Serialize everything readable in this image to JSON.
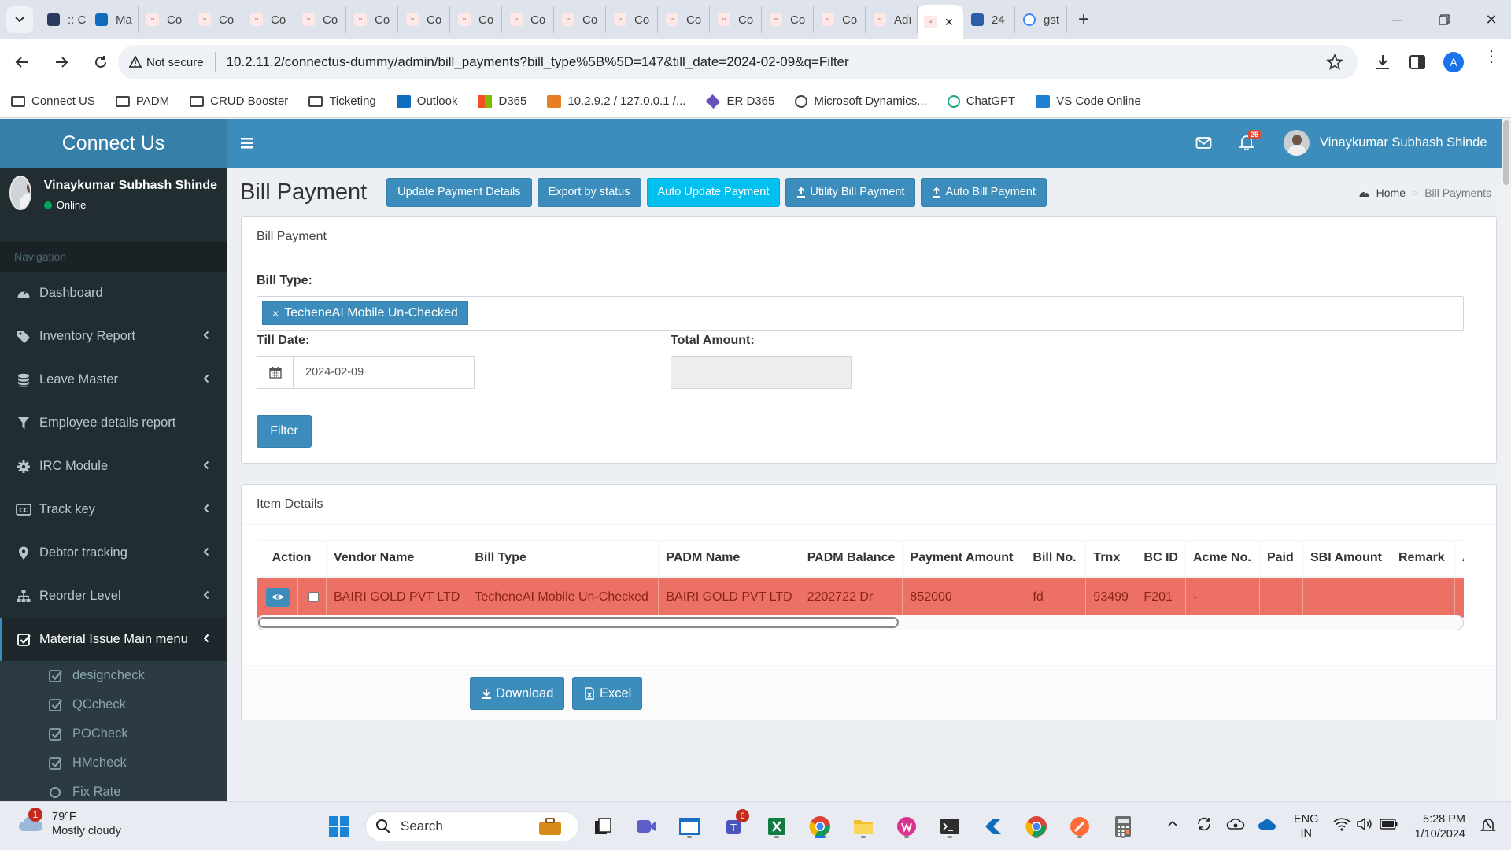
{
  "browser": {
    "tabs": [
      {
        "label": ":: C",
        "icon": "app-icon"
      },
      {
        "label": "Ma",
        "icon": "outlook-icon"
      },
      {
        "label": "Co",
        "icon": "site-icon"
      },
      {
        "label": "Co",
        "icon": "site-icon"
      },
      {
        "label": "Co",
        "icon": "site-icon"
      },
      {
        "label": "Co",
        "icon": "site-icon"
      },
      {
        "label": "Co",
        "icon": "site-icon"
      },
      {
        "label": "Co",
        "icon": "site-icon"
      },
      {
        "label": "Co",
        "icon": "site-icon"
      },
      {
        "label": "Co",
        "icon": "site-icon"
      },
      {
        "label": "Co",
        "icon": "site-icon"
      },
      {
        "label": "Co",
        "icon": "site-icon"
      },
      {
        "label": "Co",
        "icon": "site-icon"
      },
      {
        "label": "Co",
        "icon": "site-icon"
      },
      {
        "label": "Co",
        "icon": "site-icon"
      },
      {
        "label": "Co",
        "icon": "site-icon"
      },
      {
        "label": "Adı",
        "icon": "site-icon"
      }
    ],
    "active_tab_close": "✕",
    "extra_tabs": [
      {
        "label": "24",
        "icon": "app-icon"
      },
      {
        "label": "gst",
        "icon": "google-icon"
      }
    ],
    "new_tab": "+",
    "security_label": "Not secure",
    "url": "10.2.11.2/connectus-dummy/admin/bill_payments?bill_type%5B%5D=147&till_date=2024-02-09&q=Filter",
    "profile_initial": "A",
    "bookmarks": [
      {
        "label": "Connect US",
        "icon": "folder-icon"
      },
      {
        "label": "PADM",
        "icon": "folder-icon"
      },
      {
        "label": "CRUD Booster",
        "icon": "folder-icon"
      },
      {
        "label": "Ticketing",
        "icon": "folder-icon"
      },
      {
        "label": "Outlook",
        "icon": "outlook-icon"
      },
      {
        "label": "D365",
        "icon": "microsoft-icon"
      },
      {
        "label": "10.2.9.2 / 127.0.0.1 /...",
        "icon": "phpmyadmin-icon"
      },
      {
        "label": "ER D365",
        "icon": "diamond-icon"
      },
      {
        "label": "Microsoft Dynamics...",
        "icon": "globe-icon"
      },
      {
        "label": "ChatGPT",
        "icon": "chatgpt-icon"
      },
      {
        "label": "VS Code Online",
        "icon": "vscode-icon"
      }
    ]
  },
  "app": {
    "brand": "Connect Us",
    "header_user": "Vinaykumar Subhash Shinde",
    "notification_count": "25",
    "sidebar": {
      "user_name": "Vinaykumar Subhash Shinde",
      "status": "Online",
      "nav_header": "Navigation",
      "items": [
        {
          "label": "Dashboard",
          "icon": "dashboard-icon",
          "has_children": false
        },
        {
          "label": "Inventory Report",
          "icon": "tag-icon",
          "has_children": true
        },
        {
          "label": "Leave Master",
          "icon": "database-icon",
          "has_children": true
        },
        {
          "label": "Employee details report",
          "icon": "filter-icon",
          "has_children": false
        },
        {
          "label": "IRC Module",
          "icon": "gear-icon",
          "has_children": true
        },
        {
          "label": "Track key",
          "icon": "cc-icon",
          "has_children": true
        },
        {
          "label": "Debtor tracking",
          "icon": "map-marker-icon",
          "has_children": true
        },
        {
          "label": "Reorder Level",
          "icon": "sitemap-icon",
          "has_children": true
        },
        {
          "label": "Material Issue Main menu",
          "icon": "check-square-icon",
          "has_children": true,
          "active": true
        }
      ],
      "sub_items": [
        {
          "label": "designcheck",
          "icon": "check-square-icon"
        },
        {
          "label": "QCcheck",
          "icon": "check-square-icon"
        },
        {
          "label": "POCheck",
          "icon": "check-square-icon"
        },
        {
          "label": "HMcheck",
          "icon": "check-square-icon"
        },
        {
          "label": "Fix Rate",
          "icon": "circle-icon"
        }
      ]
    },
    "page_title": "Bill Payment",
    "actions": [
      "Update Payment Details",
      "Export by status",
      "Auto Update Payment",
      "Utility Bill Payment",
      "Auto Bill Payment"
    ],
    "breadcrumb": {
      "home": "Home",
      "current": "Bill Payments"
    },
    "filter_box": {
      "title": "Bill Payment",
      "bill_type_label": "Bill Type:",
      "bill_type_value": "TecheneAI Mobile Un-Checked",
      "chip_remove": "×",
      "till_date_label": "Till Date:",
      "till_date_value": "2024-02-09",
      "total_amount_label": "Total Amount:",
      "total_amount_value": "",
      "filter_button": "Filter"
    },
    "items_box": {
      "title": "Item Details",
      "columns": [
        "Action",
        "Vendor Name",
        "Bill Type",
        "PADM Name",
        "PADM Balance",
        "Payment Amount",
        "Bill No.",
        "Trnx",
        "BC ID",
        "Acme No.",
        "Paid",
        "SBI Amount",
        "Remark",
        "Adva"
      ],
      "rows": [
        {
          "vendor_name": "BAIRI GOLD PVT LTD",
          "bill_type": "TecheneAI Mobile Un-Checked",
          "padm_name": "BAIRI GOLD PVT LTD",
          "padm_balance": "2202722 Dr",
          "payment_amount": "852000",
          "bill_no": "fd",
          "trnx": "93499",
          "bc_id": "F201",
          "acme_no": "-",
          "paid": "",
          "sbi_amount": "",
          "remark": "",
          "adva": ""
        }
      ],
      "download_button": "Download",
      "excel_button": "Excel"
    },
    "row_color": "#ec7063",
    "accent_color": "#3c8dbc"
  },
  "taskbar": {
    "weather_temp": "79°F",
    "weather_desc": "Mostly cloudy",
    "weather_badge": "1",
    "search_placeholder": "Search",
    "teams_badge": "6",
    "language": "ENG",
    "region": "IN",
    "time": "5:28 PM",
    "date": "1/10/2024"
  }
}
